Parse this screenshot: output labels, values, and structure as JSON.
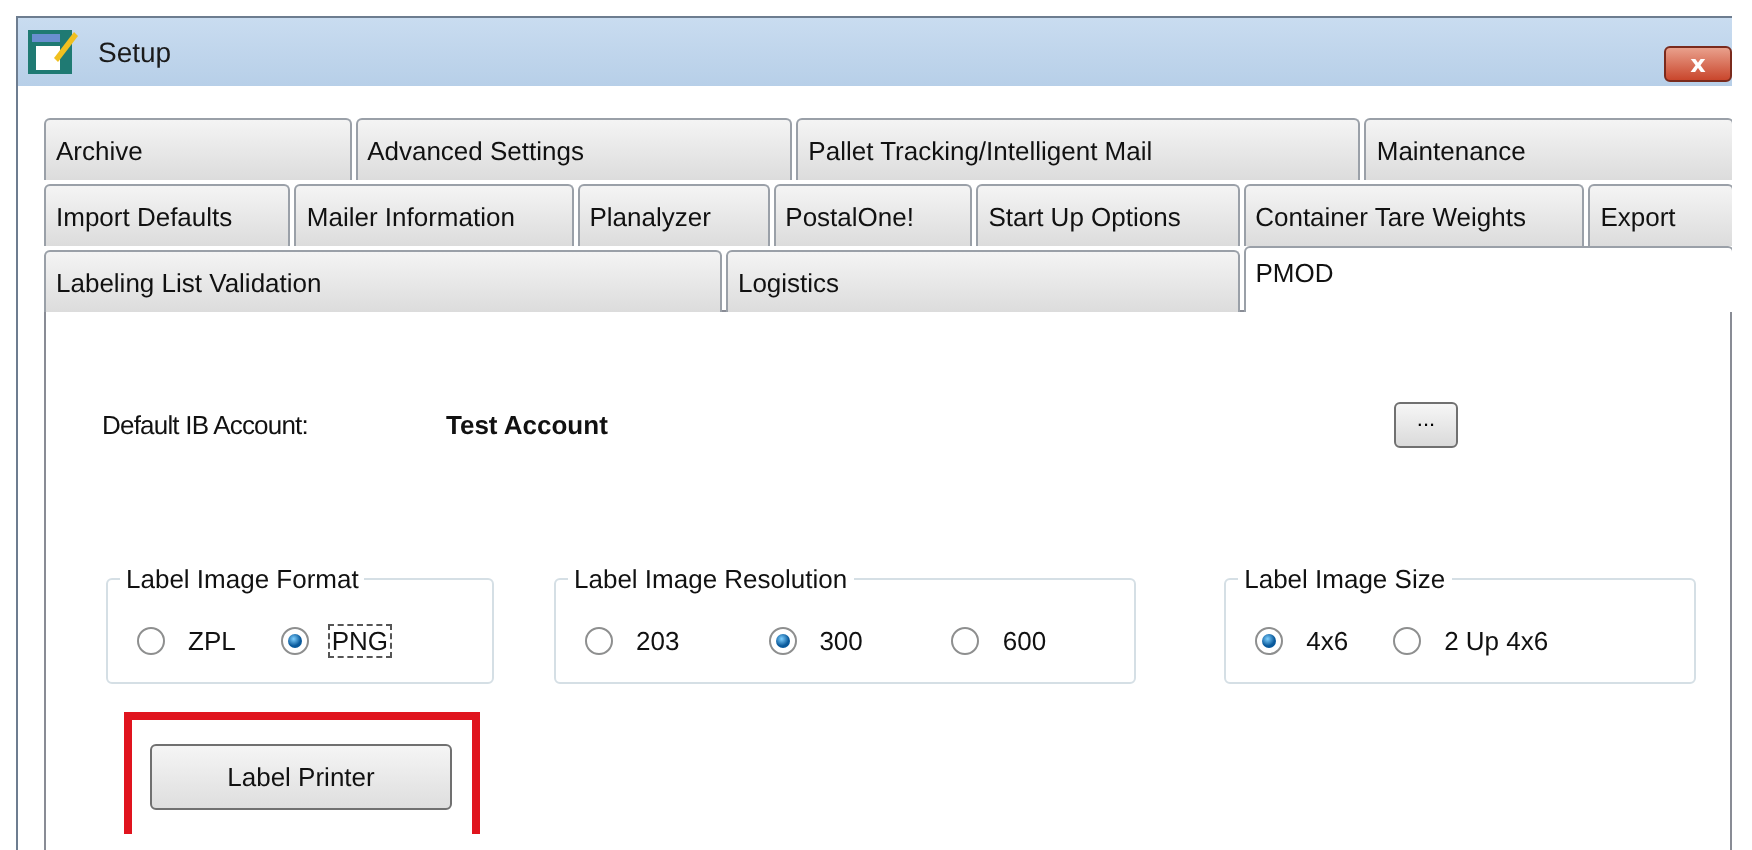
{
  "window": {
    "title": "Setup",
    "close_glyph": "x"
  },
  "tab_rows": [
    [
      {
        "label": "Archive",
        "selected": false
      },
      {
        "label": "Advanced Settings",
        "selected": false
      },
      {
        "label": "Pallet Tracking/Intelligent Mail",
        "selected": false
      },
      {
        "label": "Maintenance",
        "selected": false
      }
    ],
    [
      {
        "label": "Import Defaults",
        "selected": false
      },
      {
        "label": "Mailer Information",
        "selected": false
      },
      {
        "label": "Planalyzer",
        "selected": false
      },
      {
        "label": "PostalOne!",
        "selected": false
      },
      {
        "label": "Start Up Options",
        "selected": false
      },
      {
        "label": "Container Tare Weights",
        "selected": false
      },
      {
        "label": "Export",
        "selected": false
      }
    ],
    [
      {
        "label": "Labeling List Validation",
        "selected": false
      },
      {
        "label": "Logistics",
        "selected": false
      },
      {
        "label": "PMOD",
        "selected": true
      }
    ]
  ],
  "account": {
    "label": "Default IB Account:",
    "value": "Test Account",
    "browse_button": "..."
  },
  "groups": [
    {
      "title": "Label Image Format",
      "options": [
        {
          "label": "ZPL",
          "selected": false,
          "focused": false
        },
        {
          "label": "PNG",
          "selected": true,
          "focused": true
        }
      ]
    },
    {
      "title": "Label Image Resolution",
      "options": [
        {
          "label": "203",
          "selected": false,
          "focused": false
        },
        {
          "label": "300",
          "selected": true,
          "focused": false
        },
        {
          "label": "600",
          "selected": false,
          "focused": false
        }
      ]
    },
    {
      "title": "Label Image Size",
      "options": [
        {
          "label": "4x6",
          "selected": true,
          "focused": false
        },
        {
          "label": "2 Up 4x6",
          "selected": false,
          "focused": false
        }
      ]
    }
  ],
  "label_printer_button": {
    "label": "Label Printer",
    "highlighted": true
  }
}
